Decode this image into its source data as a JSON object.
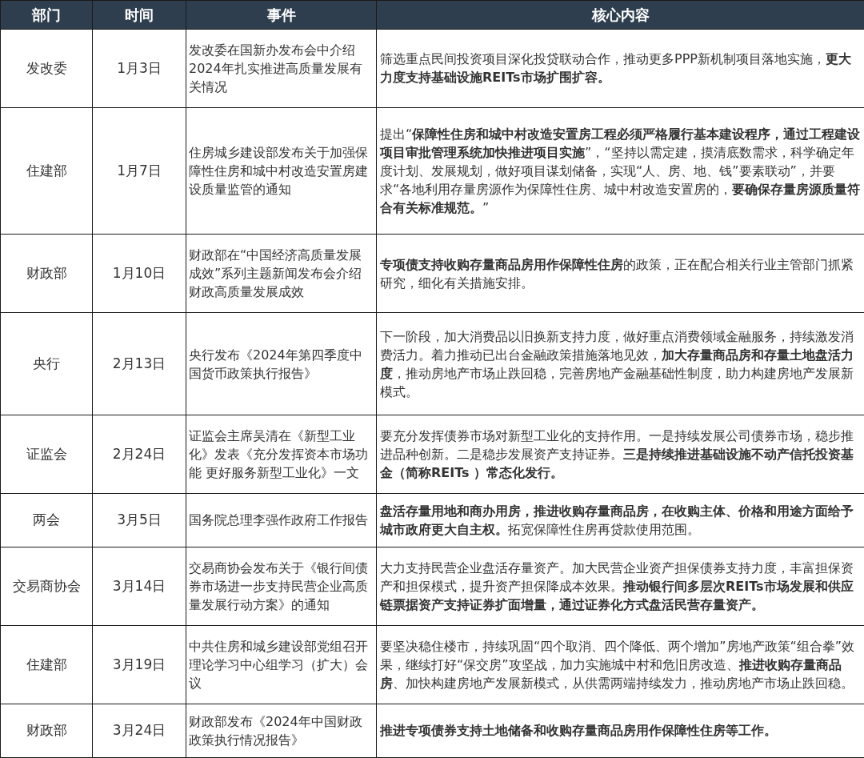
{
  "table": {
    "columns": [
      "部门",
      "时间",
      "事件",
      "核心内容"
    ],
    "rows": [
      {
        "department": "发改委",
        "date": "1月3日",
        "event": "发改委在国新办发布会中介绍2024年扎实推进高质量发展有关情况",
        "content": "筛选重点民间投资项目深化投贷联动合作，推动更多PPP新机制项目落地实施，**更大力度支持基础设施REITs市场扩围扩容。**"
      },
      {
        "department": "住建部",
        "date": "1月7日",
        "event": "住房城乡建设部发布关于加强保障性住房和城中村改造安置房建设质量监管的通知",
        "content": "提出“**保障性住房和城中村改造安置房工程必须严格履行基本建设程序，通过工程建设项目审批管理系统加快推进项目实施**”，“坚持以需定建，摸清底数需求，科学确定年度计划、发展规划，做好项目谋划储备，实现“人、房、地、钱”要素联动”，并要求“各地利用存量房源作为保障性住房、城中村改造安置房的，**要确保存量房源质量符合有关标准规范。**”"
      },
      {
        "department": "财政部",
        "date": "1月10日",
        "event": "财政部在“中国经济高质量发展成效”系列主题新闻发布会介绍财政高质量发展成效",
        "content": "**专项债支持收购存量商品房用作保障性住房**的政策，正在配合相关行业主管部门抓紧研究，细化有关措施安排。"
      },
      {
        "department": "央行",
        "date": "2月13日",
        "event": "央行发布《2024年第四季度中国货币政策执行报告》",
        "content": "下一阶段，加大消费品以旧换新支持力度，做好重点消费领域金融服务，持续激发消费活力。着力推动已出台金融政策措施落地见效，**加大存量商品房和存量土地盘活力度**，推动房地产市场止跌回稳，完善房地产金融基础性制度，助力构建房地产发展新模式。"
      },
      {
        "department": "证监会",
        "date": "2月24日",
        "event": "证监会主席吴清在《新型工业化》发表《充分发挥资本市场功能 更好服务新型工业化》一文",
        "content": "要充分发挥债券市场对新型工业化的支持作用。一是持续发展公司债券市场，稳步推进品种创新。二是稳步发展资产支持证券。**三是持续推进基础设施不动产信托投资基金（简称REITs ）常态化发行。**"
      },
      {
        "department": "两会",
        "date": "3月5日",
        "event": "国务院总理李强作政府工作报告",
        "content": "**盘活存量用地和商办用房，推进收购存量商品房，在收购主体、价格和用途方面给予城市政府更大自主权。**拓宽保障性住房再贷款使用范围。"
      },
      {
        "department": "交易商协会",
        "date": "3月14日",
        "event": "交易商协会发布关于《银行间债券市场进一步支持民营企业高质量发展行动方案》的通知",
        "content": "大力支持民营企业盘活存量资产。加大民营企业资产担保债券支持力度，丰富担保资产和担保模式，提升资产担保降成本效果。**推动银行间多层次REITs市场发展和供应链票据资产支持证券扩面增量，通过证券化方式盘活民营存量资产。**"
      },
      {
        "department": "住建部",
        "date": "3月19日",
        "event": "中共住房和城乡建设部党组召开理论学习中心组学习（扩大）会议",
        "content": "要坚决稳住楼市，持续巩固“四个取消、四个降低、两个增加”房地产政策“组合拳”效果，继续打好“保交房”攻坚战，加力实施城中村和危旧房改造、**推进收购存量商品房**、加快构建房地产发展新模式，从供需两端持续发力，推动房地产市场止跌回稳。"
      },
      {
        "department": "财政部",
        "date": "3月24日",
        "event": "财政部发布《2024年中国财政政策执行情况报告》",
        "content": "**推进专项债券支持土地储备和收购存量商品房用作保障性住房等工作。**"
      }
    ]
  }
}
